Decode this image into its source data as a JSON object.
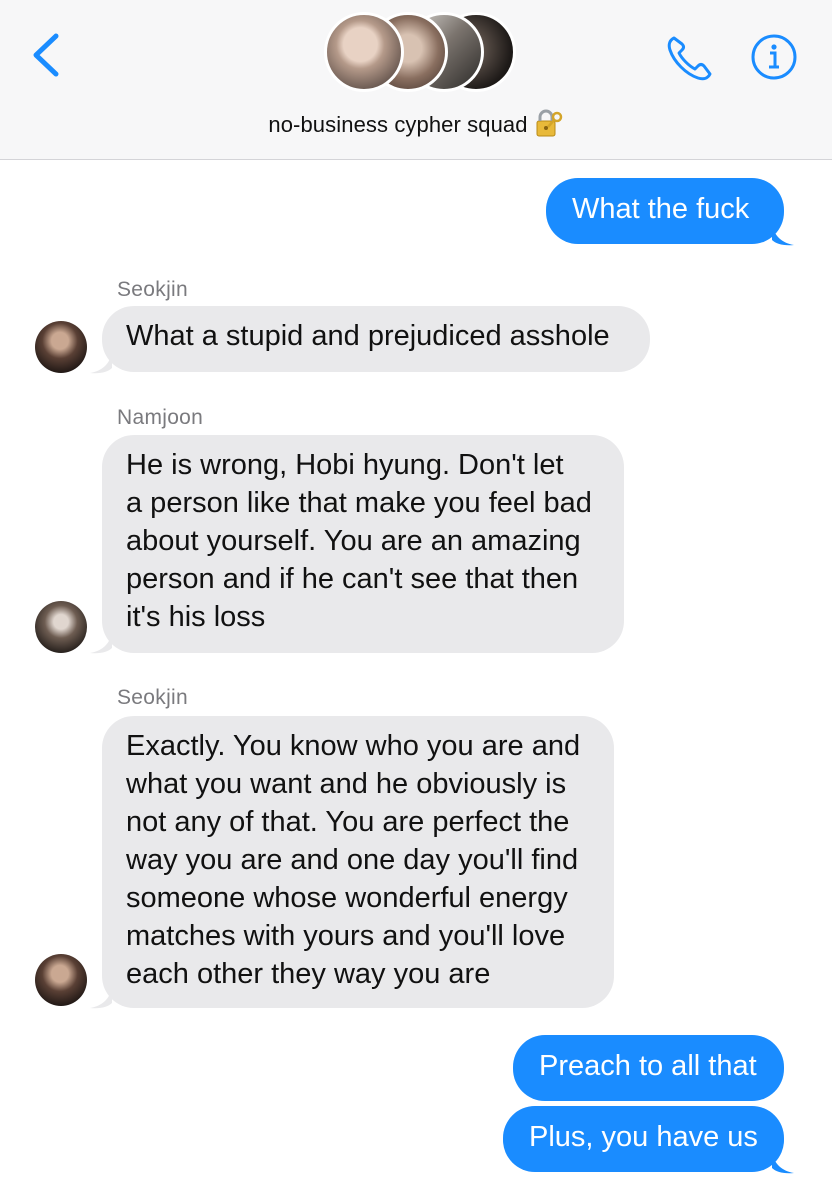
{
  "header": {
    "back_icon": "chevron-left-icon",
    "group_name": "no-business cypher squad",
    "title_emoji": "lock-with-key-icon",
    "call_icon": "phone-icon",
    "info_icon": "info-icon",
    "accent_color": "#1a8cff"
  },
  "messages": [
    {
      "direction": "outgoing",
      "text": "What the fuck"
    },
    {
      "direction": "incoming",
      "sender": "Seokjin",
      "text": "What a stupid and prejudiced asshole"
    },
    {
      "direction": "incoming",
      "sender": "Namjoon",
      "text": "He is wrong, Hobi hyung. Don't let\na person like that make you feel bad\nabout yourself. You are an amazing\nperson and if he can't see that then\nit's his loss"
    },
    {
      "direction": "incoming",
      "sender": "Seokjin",
      "text": "Exactly. You know who you are and\nwhat you want and he obviously is\nnot any of that. You are perfect the\nway you are and one day you'll find\nsomeone whose wonderful energy\nmatches with yours and you'll love\neach other they way you are"
    },
    {
      "direction": "outgoing",
      "text": "Preach to all that"
    },
    {
      "direction": "outgoing",
      "text": "Plus, you have us"
    }
  ],
  "colors": {
    "outgoing_bubble": "#1a8cff",
    "incoming_bubble": "#e9e9eb",
    "sender_name": "#7a7a7e"
  }
}
